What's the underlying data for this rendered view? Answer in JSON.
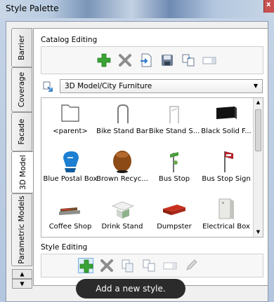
{
  "window": {
    "title": "Style Palette",
    "close_label": "x"
  },
  "tabs": [
    {
      "label": "Barrier",
      "active": false
    },
    {
      "label": "Coverage",
      "active": false
    },
    {
      "label": "Facade",
      "active": false
    },
    {
      "label": "3D Model",
      "active": true
    },
    {
      "label": "Parametric Models",
      "active": false
    }
  ],
  "tab_scroll": {
    "up": "▲",
    "down": "▼"
  },
  "catalog_editing": {
    "label": "Catalog Editing",
    "buttons": [
      "add-icon",
      "delete-icon",
      "import-icon",
      "save-icon",
      "duplicate-icon",
      "rename-icon"
    ]
  },
  "path_select": {
    "value": "3D Model/City Furniture",
    "arrow": "▼"
  },
  "grid": {
    "items": [
      {
        "caption": "<parent>",
        "icon": "folder-icon"
      },
      {
        "caption": "Bike Stand Bar",
        "icon": "bike-stand-icon"
      },
      {
        "caption": "Bike Stand S...",
        "icon": "bike-stand-s-icon"
      },
      {
        "caption": "Black Solid F...",
        "icon": "black-solid-icon"
      },
      {
        "caption": "Blue Postal Box",
        "icon": "postal-box-icon"
      },
      {
        "caption": "Brown Recyc...",
        "icon": "recycle-bin-icon"
      },
      {
        "caption": "Bus Stop",
        "icon": "bus-stop-icon"
      },
      {
        "caption": "Bus Stop Sign",
        "icon": "bus-stop-sign-icon"
      },
      {
        "caption": "Coffee Shop",
        "icon": "coffee-shop-icon"
      },
      {
        "caption": "Drink Stand",
        "icon": "drink-stand-icon"
      },
      {
        "caption": "Dumpster",
        "icon": "dumpster-icon"
      },
      {
        "caption": "Electrical  Box",
        "icon": "electrical-box-icon"
      }
    ],
    "scroll": {
      "up": "▲",
      "down": "▼"
    }
  },
  "style_editing": {
    "label": "Style Editing",
    "buttons": [
      "add-icon",
      "delete-icon",
      "copy-icon",
      "duplicate-icon",
      "rename-icon",
      "edit-icon"
    ]
  },
  "tooltip": "Add a new style.",
  "colors": {
    "titlebar": "#b8cbe0",
    "add_green": "#3aa335",
    "tooltip_bg": "#2b2b2b"
  }
}
